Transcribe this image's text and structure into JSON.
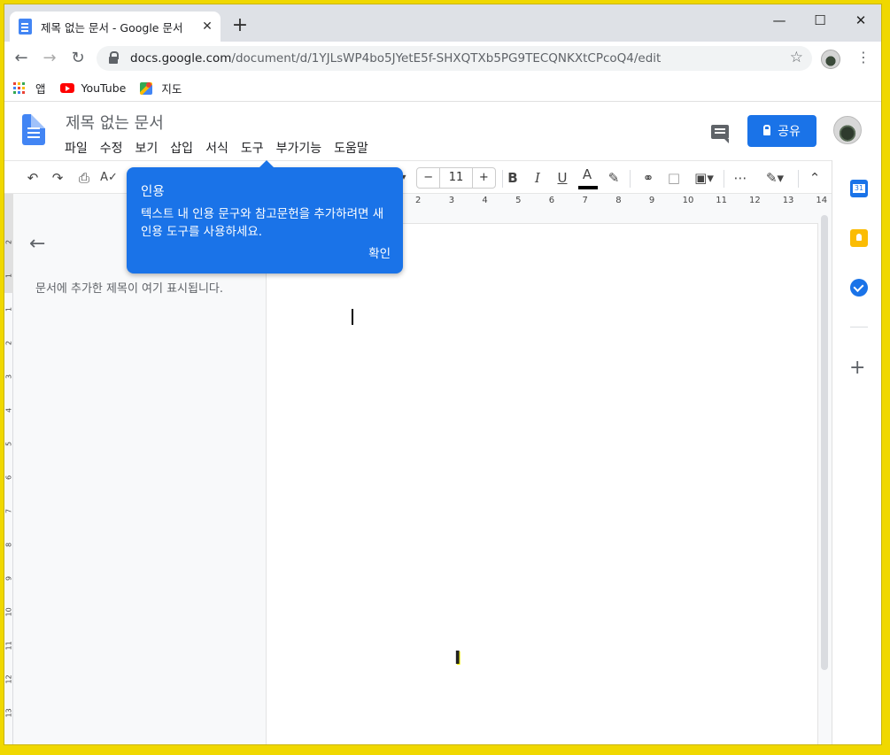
{
  "browser": {
    "tab_title": "제목 없는 문서 - Google 문서",
    "tab_close": "✕",
    "new_tab": "+",
    "url_host": "docs.google.com",
    "url_path": "/document/d/1YJLsWP4bo5JYetE5f-SHXQTXb5PG9TECQNKXtCPcoQ4/edit",
    "bookmarks": [
      {
        "label": "앱",
        "icon": "apps-grid-icon"
      },
      {
        "label": "YouTube",
        "icon": "youtube-icon"
      },
      {
        "label": "지도",
        "icon": "maps-icon"
      }
    ]
  },
  "docs": {
    "title": "제목 없는 문서",
    "menu": [
      "파일",
      "수정",
      "보기",
      "삽입",
      "서식",
      "도구",
      "부가기능",
      "도움말"
    ],
    "share_label": "공유",
    "font_size": "11",
    "outline_placeholder": "문서에 추가한 제목이 여기 표시됩니다."
  },
  "tooltip": {
    "title": "인용",
    "body": "텍스트 내 인용 문구와 참고문헌을 추가하려면 새 인용 도구를 사용하세요.",
    "ok": "확인"
  },
  "ruler": {
    "horizontal": [
      "2",
      "3",
      "4",
      "5",
      "6",
      "7",
      "8",
      "9",
      "10",
      "11",
      "12",
      "13",
      "14"
    ],
    "vertical": [
      "2",
      "1",
      "1",
      "2",
      "3",
      "4",
      "5",
      "6",
      "7",
      "8",
      "9",
      "10",
      "11",
      "12",
      "13"
    ]
  },
  "colors": {
    "accent": "#1a73e8",
    "frame": "#f0d800"
  }
}
